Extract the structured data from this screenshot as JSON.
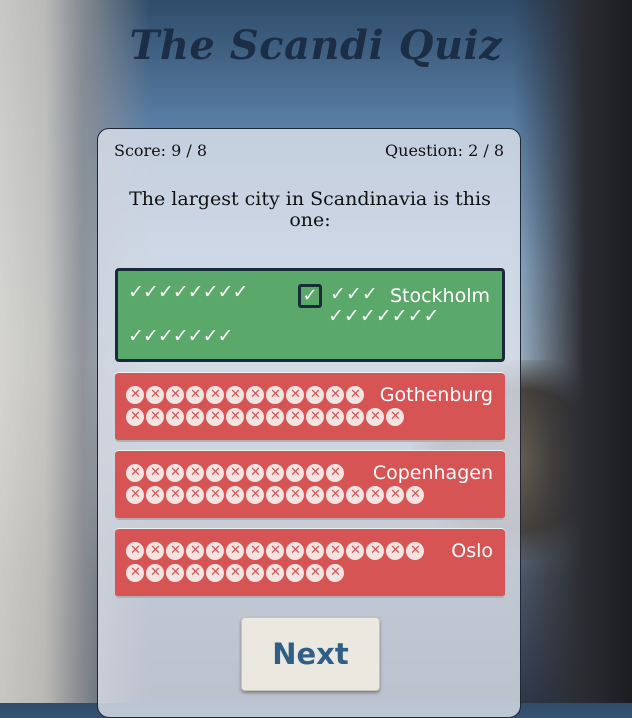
{
  "app": {
    "title": "The Scandi Quiz"
  },
  "status": {
    "score": "Score: 9 / 8",
    "question": "Question: 2 / 8"
  },
  "question_text": "The largest city in Scandinavia is this one:",
  "answers": [
    {
      "label": "Stockholm",
      "state": "correct",
      "icon": "check-icon"
    },
    {
      "label": "Gothenburg",
      "state": "wrong",
      "icon": "x-circle-icon"
    },
    {
      "label": "Copenhagen",
      "state": "wrong",
      "icon": "x-circle-icon"
    },
    {
      "label": "Oslo",
      "state": "wrong",
      "icon": "x-circle-icon"
    }
  ],
  "next_button": {
    "label": "Next"
  },
  "colors": {
    "correct": "#5aa86a",
    "wrong": "#d65454",
    "title": "#1c2e45",
    "next_text": "#2f5f86"
  }
}
